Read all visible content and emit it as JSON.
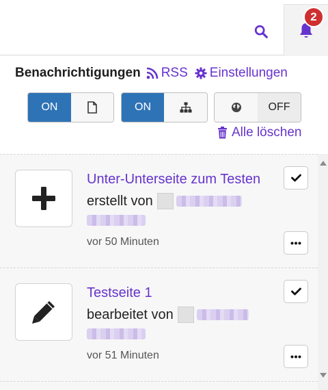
{
  "header": {
    "notification_count": "2"
  },
  "panel": {
    "title": "Benachrichtigungen",
    "rss_label": "RSS",
    "settings_label": "Einstellungen",
    "clear_all_label": "Alle löschen"
  },
  "toggles": [
    {
      "state_label": "ON",
      "state": "on",
      "icon": "page-icon"
    },
    {
      "state_label": "ON",
      "state": "on",
      "icon": "sitemap-icon"
    },
    {
      "state_label": "OFF",
      "state": "off",
      "icon": "globe-icon"
    }
  ],
  "notifications": [
    {
      "page_title": "Unter-Unterseite zum Testen",
      "action": "erstellt von",
      "time": "vor 50 Minuten",
      "icon": "plus-icon"
    },
    {
      "page_title": "Testseite 1",
      "action": "bearbeitet von",
      "time": "vor 51 Minuten",
      "icon": "pencil-icon"
    }
  ],
  "colors": {
    "accent": "#6633cc",
    "toggle_on": "#2e73b6",
    "badge": "#cf2f2f"
  }
}
